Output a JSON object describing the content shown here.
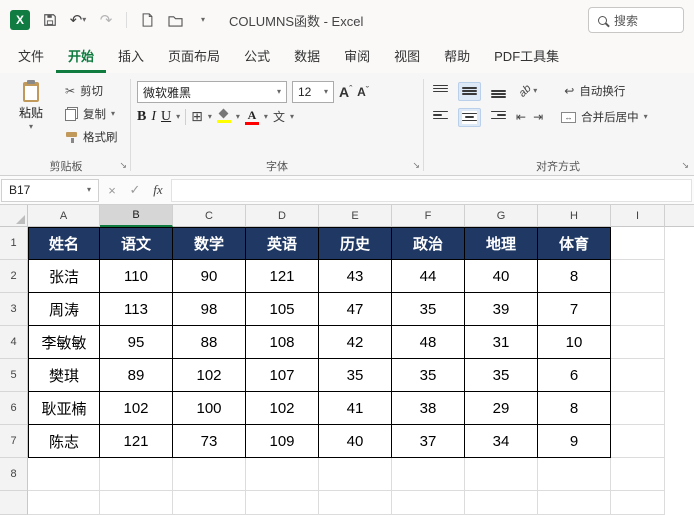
{
  "titlebar": {
    "title": "COLUMNS函数 - Excel",
    "search_placeholder": "搜索"
  },
  "tabs": [
    {
      "label": "文件"
    },
    {
      "label": "开始",
      "active": true
    },
    {
      "label": "插入"
    },
    {
      "label": "页面布局"
    },
    {
      "label": "公式"
    },
    {
      "label": "数据"
    },
    {
      "label": "审阅"
    },
    {
      "label": "视图"
    },
    {
      "label": "帮助"
    },
    {
      "label": "PDF工具集"
    }
  ],
  "ribbon": {
    "clipboard": {
      "group_label": "剪贴板",
      "paste_label": "粘贴",
      "cut_label": "剪切",
      "copy_label": "复制",
      "format_painter_label": "格式刷"
    },
    "font": {
      "group_label": "字体",
      "font_name": "微软雅黑",
      "font_size": "12",
      "bold": "B",
      "italic": "I",
      "underline": "U",
      "phonetic": "文"
    },
    "alignment": {
      "group_label": "对齐方式",
      "wrap_label": "自动换行",
      "merge_label": "合并后居中"
    }
  },
  "formula_bar": {
    "name_box": "B17",
    "fx_label": "fx",
    "formula": ""
  },
  "icons": {
    "excel_logo": "X",
    "undo": "↶",
    "redo": "↷",
    "chevron": "▾",
    "scissors": "✂",
    "borders_glyph": "⊞",
    "letter_a": "A",
    "caret_up": "ˆ",
    "caret_down": "ˇ",
    "wrap_arrow": "↩",
    "merge_arrow": "↔",
    "indent_left": "⇤",
    "indent_right": "⇥",
    "launcher": "↘",
    "close": "×",
    "check": "✓",
    "orientation": "ab"
  },
  "colors": {
    "accent_green": "#107C41",
    "table_header_fill": "#1F3864",
    "fill_color_bar": "#FFFF00",
    "font_color_bar": "#FF0000"
  },
  "sheet": {
    "columns": [
      "A",
      "B",
      "C",
      "D",
      "E",
      "F",
      "G",
      "H",
      "I"
    ],
    "selected_column": "B",
    "rows": [
      "1",
      "2",
      "3",
      "4",
      "5",
      "6",
      "7",
      "8"
    ],
    "table": {
      "header": [
        "姓名",
        "语文",
        "数学",
        "英语",
        "历史",
        "政治",
        "地理",
        "体育"
      ],
      "data": [
        [
          "张洁",
          "110",
          "90",
          "121",
          "43",
          "44",
          "40",
          "8"
        ],
        [
          "周涛",
          "113",
          "98",
          "105",
          "47",
          "35",
          "39",
          "7"
        ],
        [
          "李敏敏",
          "95",
          "88",
          "108",
          "42",
          "48",
          "31",
          "10"
        ],
        [
          "樊琪",
          "89",
          "102",
          "107",
          "35",
          "35",
          "35",
          "6"
        ],
        [
          "耿亚楠",
          "102",
          "100",
          "102",
          "41",
          "38",
          "29",
          "8"
        ],
        [
          "陈志",
          "121",
          "73",
          "109",
          "40",
          "37",
          "34",
          "9"
        ]
      ]
    }
  }
}
